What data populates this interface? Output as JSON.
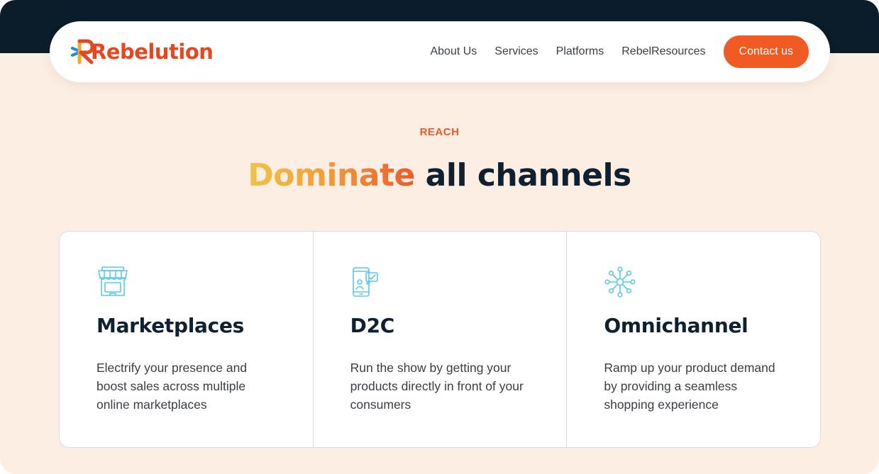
{
  "brand": {
    "name": "Rebelution",
    "logo_icon": "rebelution-logo-icon",
    "colors": {
      "accent": "#f15a22",
      "dark": "#0b1c2b",
      "icon": "#5bc8e8"
    }
  },
  "nav": {
    "items": [
      {
        "label": "About Us"
      },
      {
        "label": "Services"
      },
      {
        "label": "Platforms"
      },
      {
        "label": "RebelResources"
      }
    ],
    "cta_label": "Contact us"
  },
  "section": {
    "eyebrow": "REACH",
    "headline_highlight": "Dominate",
    "headline_rest": " all channels"
  },
  "cards": [
    {
      "icon": "storefront-icon",
      "title": "Marketplaces",
      "description": "Electrify your presence and boost sales across multiple online marketplaces"
    },
    {
      "icon": "mobile-checkmark-icon",
      "title": "D2C",
      "description": "Run the show by getting your products directly in front of your consumers"
    },
    {
      "icon": "network-hub-icon",
      "title": "Omnichannel",
      "description": "Ramp up your product demand by providing a seamless shopping experience"
    }
  ]
}
